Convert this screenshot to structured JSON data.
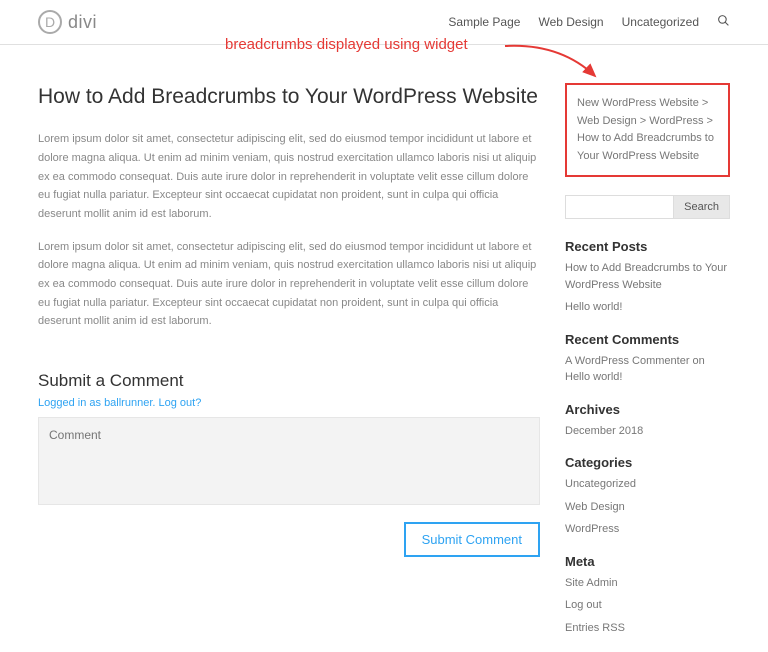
{
  "logo": {
    "glyph": "D",
    "text": "divi"
  },
  "nav": {
    "items": [
      "Sample Page",
      "Web Design",
      "Uncategorized"
    ]
  },
  "annotation": "breadcrumbs displayed using widget",
  "page": {
    "title": "How to Add Breadcrumbs to Your WordPress Website",
    "p1": "Lorem ipsum dolor sit amet, consectetur adipiscing elit, sed do eiusmod tempor incididunt ut labore et dolore magna aliqua. Ut enim ad minim veniam, quis nostrud exercitation ullamco laboris nisi ut aliquip ex ea commodo consequat. Duis aute irure dolor in reprehenderit in voluptate velit esse cillum dolore eu fugiat nulla pariatur. Excepteur sint occaecat cupidatat non proident, sunt in culpa qui officia deserunt mollit anim id est laborum.",
    "p2": "Lorem ipsum dolor sit amet, consectetur adipiscing elit, sed do eiusmod tempor incididunt ut labore et dolore magna aliqua. Ut enim ad minim veniam, quis nostrud exercitation ullamco laboris nisi ut aliquip ex ea commodo consequat. Duis aute irure dolor in reprehenderit in voluptate velit esse cillum dolore eu fugiat nulla pariatur. Excepteur sint occaecat cupidatat non proident, sunt in culpa qui officia deserunt mollit anim id est laborum."
  },
  "comments": {
    "heading": "Submit a Comment",
    "logged_in_prefix": "Logged in as ",
    "user": "ballrunner",
    "logout": "Log out?",
    "placeholder": "Comment",
    "submit": "Submit Comment"
  },
  "sidebar": {
    "breadcrumbs": {
      "parts": [
        "New WordPress Website",
        "Web Design",
        "WordPress",
        "How to Add Breadcrumbs to Your WordPress Website"
      ],
      "sep": " > "
    },
    "search_label": "Search",
    "recent_posts": {
      "title": "Recent Posts",
      "items": [
        "How to Add Breadcrumbs to Your WordPress Website",
        "Hello world!"
      ]
    },
    "recent_comments": {
      "title": "Recent Comments",
      "text": "A WordPress Commenter on Hello world!"
    },
    "archives": {
      "title": "Archives",
      "items": [
        "December 2018"
      ]
    },
    "categories": {
      "title": "Categories",
      "items": [
        "Uncategorized",
        "Web Design",
        "WordPress"
      ]
    },
    "meta": {
      "title": "Meta",
      "items": [
        "Site Admin",
        "Log out",
        "Entries RSS"
      ]
    }
  }
}
